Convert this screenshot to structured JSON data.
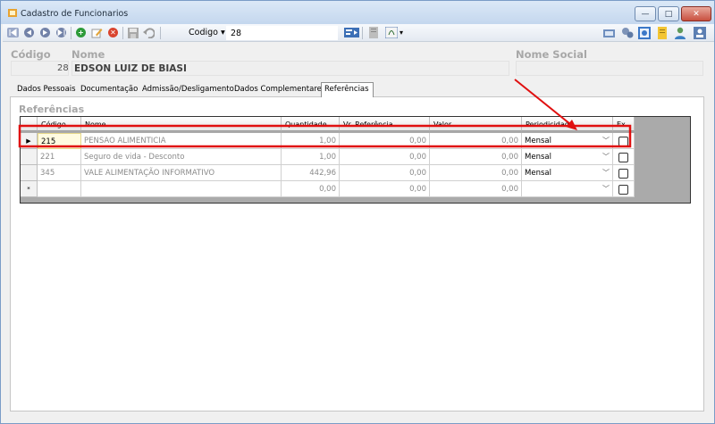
{
  "window": {
    "title": "Cadastro de Funcionarios",
    "buttons": {
      "minimize": "—",
      "maximize": "□",
      "close": "✕"
    }
  },
  "toolbar": {
    "search_field_label": "Codigo",
    "search_value": "28",
    "icons": [
      "first-record-icon",
      "prev-record-icon",
      "next-record-icon",
      "last-record-icon",
      "add-icon",
      "edit-icon",
      "delete-icon",
      "save-icon",
      "undo-icon",
      "refresh-icon",
      "print-icon",
      "report-icon",
      "link-icon",
      "settings-icon",
      "calculator-icon",
      "bookmark-icon",
      "user-icon",
      "help-icon"
    ],
    "colors": {
      "add": "#2e9b3a",
      "delete": "#d9442f",
      "nav": "#6f7fa6"
    }
  },
  "employee": {
    "codigo_label": "Código",
    "nome_label": "Nome",
    "nome_social_label": "Nome Social",
    "codigo": "28",
    "nome": "EDSON LUIZ DE BIASI",
    "nome_social": ""
  },
  "tabs": [
    {
      "label": "Dados Pessoais"
    },
    {
      "label": "Documentação"
    },
    {
      "label": "Admissão/Desligamento"
    },
    {
      "label": "Dados Complementares"
    },
    {
      "label": "Referências",
      "active": true
    }
  ],
  "referencias": {
    "group_title": "Referências",
    "columns": [
      "Código",
      "Nome",
      "Quantidade",
      "Vr. Referência",
      "Valor",
      "Periodicidade",
      "Ex"
    ],
    "rows": [
      {
        "marker": "▶",
        "codigo": "215",
        "nome": "PENSAO ALIMENTICIA",
        "quantidade": "1,00",
        "vr_referencia": "0,00",
        "valor": "0,00",
        "periodicidade": "Mensal",
        "ex": false,
        "selected": true
      },
      {
        "marker": "",
        "codigo": "221",
        "nome": "Seguro de vida - Desconto",
        "quantidade": "1,00",
        "vr_referencia": "0,00",
        "valor": "0,00",
        "periodicidade": "Mensal",
        "ex": false
      },
      {
        "marker": "",
        "codigo": "345",
        "nome": "VALE ALIMENTAÇÃO INFORMATIVO",
        "quantidade": "442,96",
        "vr_referencia": "0,00",
        "valor": "0,00",
        "periodicidade": "Mensal",
        "ex": false
      },
      {
        "marker": "*",
        "codigo": "",
        "nome": "",
        "quantidade": "0,00",
        "vr_referencia": "0,00",
        "valor": "0,00",
        "periodicidade": "",
        "ex": false
      }
    ]
  },
  "annotation": {
    "color": "#e01010"
  }
}
